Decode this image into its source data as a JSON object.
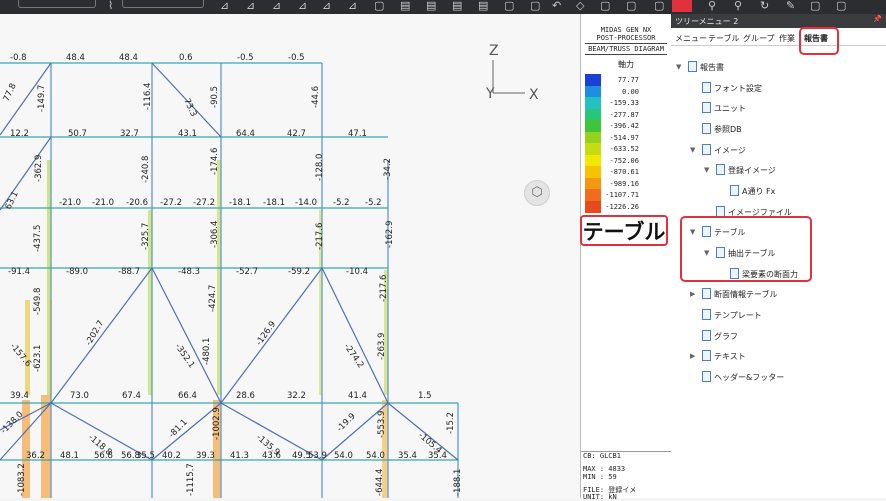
{
  "legend": {
    "header_lines": [
      "MIDAS GEN NX",
      "POST-PROCESSOR",
      "BEAM/TRUSS DIAGRAM"
    ],
    "quantity": "軸力",
    "values": [
      "77.77",
      "0.00",
      "-159.33",
      "-277.87",
      "-396.42",
      "-514.97",
      "-633.52",
      "-752.06",
      "-870.61",
      "-989.16",
      "-1107.71",
      "-1226.26"
    ],
    "colors": [
      "#1a3fd6",
      "#1f8ee0",
      "#23c1c4",
      "#27c77a",
      "#41c43a",
      "#95d11d",
      "#c7dc10",
      "#f2e800",
      "#f7c200",
      "#f49712",
      "#ef6d1c",
      "#e84a1d"
    ],
    "footer_lines": [
      "CB: GLCB1",
      "MAX : 4833",
      "MIN : 59",
      "FILE: 登録イメ",
      "UNIT: kN"
    ]
  },
  "callout": "テーブル",
  "axes": {
    "z": "Z",
    "y": "Y",
    "x": "X"
  },
  "tree": {
    "title": "ツリーメニュー 2",
    "pin": "📌",
    "tabs": [
      "メニュー",
      "テーブル",
      "グループ",
      "作業",
      "報告書"
    ],
    "nodes": [
      {
        "label": "報告書",
        "toggle": "▼"
      },
      {
        "label": "フォント設定",
        "toggle": ""
      },
      {
        "label": "ユニット",
        "toggle": ""
      },
      {
        "label": "参照DB",
        "toggle": ""
      },
      {
        "label": "イメージ",
        "toggle": "▼"
      },
      {
        "label": "登録イメージ",
        "toggle": "▼"
      },
      {
        "label": "A通り Fx",
        "toggle": ""
      },
      {
        "label": "イメージファイル",
        "toggle": ""
      },
      {
        "label": "テーブル",
        "toggle": "▼"
      },
      {
        "label": "抽出テーブル",
        "toggle": "▼"
      },
      {
        "label": "梁要素の断面力",
        "toggle": ""
      },
      {
        "label": "断面情報テーブル",
        "toggle": "▶"
      },
      {
        "label": "テンプレート",
        "toggle": ""
      },
      {
        "label": "グラフ",
        "toggle": ""
      },
      {
        "label": "テキスト",
        "toggle": "▶"
      },
      {
        "label": "ヘッダー&フッター",
        "toggle": ""
      }
    ]
  },
  "diagram_labels": [
    "-0.8",
    "48.4",
    "48.4",
    "0.6",
    "-0.5",
    "-0.5",
    "77.8",
    "-149.7",
    "-116.4",
    "73.3",
    "-90.5",
    "-44.6",
    "12.2",
    "50.7",
    "32.7",
    "43.1",
    "64.4",
    "42.7",
    "47.1",
    "-362.9",
    "-240.8",
    "-174.6",
    "-128.0",
    "-34.2",
    "63.1",
    "-21.0",
    "-21.0",
    "-20.6",
    "-27.2",
    "-27.2",
    "-18.1",
    "-18.1",
    "-14.0",
    "-5.2",
    "-5.2",
    "-437.5",
    "-325.7",
    "-306.4",
    "-217.6",
    "-162.9",
    "-91.4",
    "-89.0",
    "-88.7",
    "-48.3",
    "-52.7",
    "-59.2",
    "-10.4",
    "-549.8",
    "-424.7",
    "-217.6",
    "-157.6",
    "-202.7",
    "-352.1",
    "-126.9",
    "-274.2",
    "-480.1",
    "-263.9",
    "-623.1",
    "39.4",
    "73.0",
    "67.4",
    "66.4",
    "28.6",
    "32.2",
    "41.4",
    "1.5",
    "-118.8",
    "-81.1",
    "-1002.9",
    "-135.9",
    "-19.9",
    "-553.9",
    "-105.4",
    "-15.2",
    "-138.0",
    "36.2",
    "48.1",
    "56.8",
    "56.8",
    "35.5",
    "40.2",
    "39.3",
    "41.3",
    "43.6",
    "49.5",
    "53.9",
    "54.0",
    "54.0",
    "35.4",
    "35.4",
    "-1083.2",
    "-1115.7",
    "-644.4",
    "-188.1"
  ]
}
